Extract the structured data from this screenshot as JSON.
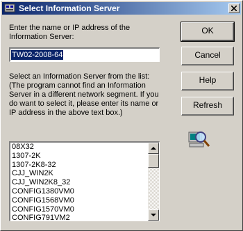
{
  "window": {
    "title": "Select Information Server"
  },
  "form": {
    "prompt_line1": "Enter the name or IP address of the",
    "prompt_line2": "Information Server:",
    "server_value": "TW02-2008-64",
    "list_label_line1": "Select an Information Server from the list:",
    "list_label_line2": "(The program cannot find an Information",
    "list_label_line3": "Server in a different network segment. If you",
    "list_label_line4": "do want to select it, please enter its name or",
    "list_label_line5": "IP address in the above text box.)"
  },
  "buttons": {
    "ok": "OK",
    "cancel": "Cancel",
    "help": "Help",
    "refresh": "Refresh"
  },
  "server_list": [
    "08X32",
    "1307-2K",
    "1307-2K8-32",
    "CJJ_WIN2K",
    "CJJ_WIN2K8_32",
    "CONFIG1380VM0",
    "CONFIG1568VM0",
    "CONFIG1570VM0",
    "CONFIG791VM2"
  ],
  "icons": {
    "window_icon": "app-icon",
    "search": "search-computer-icon"
  }
}
